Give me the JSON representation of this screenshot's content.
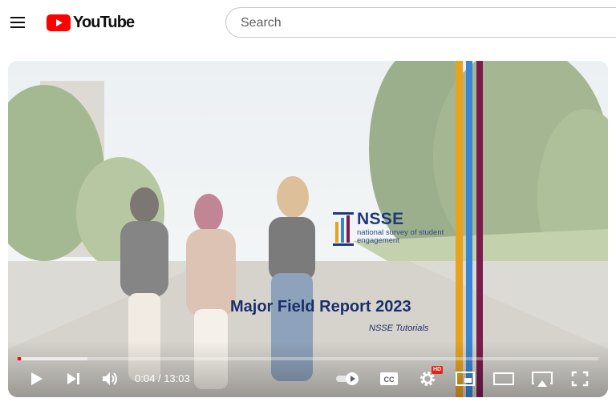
{
  "masthead": {
    "logo_text": "YouTube",
    "search_placeholder": "Search"
  },
  "video": {
    "slide_title": "Major Field Report 2023",
    "slide_subtitle": "NSSE Tutorials",
    "org_name": "NSSE",
    "org_tagline": "national survey of student engagement",
    "brand_colors": [
      "#e8a21e",
      "#3a86d6",
      "#7a1d4e"
    ]
  },
  "controls": {
    "current_time": "0:04",
    "duration": "13:03",
    "progress": 0.005,
    "buffered": 0.12,
    "hd_badge": "HD",
    "autoplay_on": true
  }
}
